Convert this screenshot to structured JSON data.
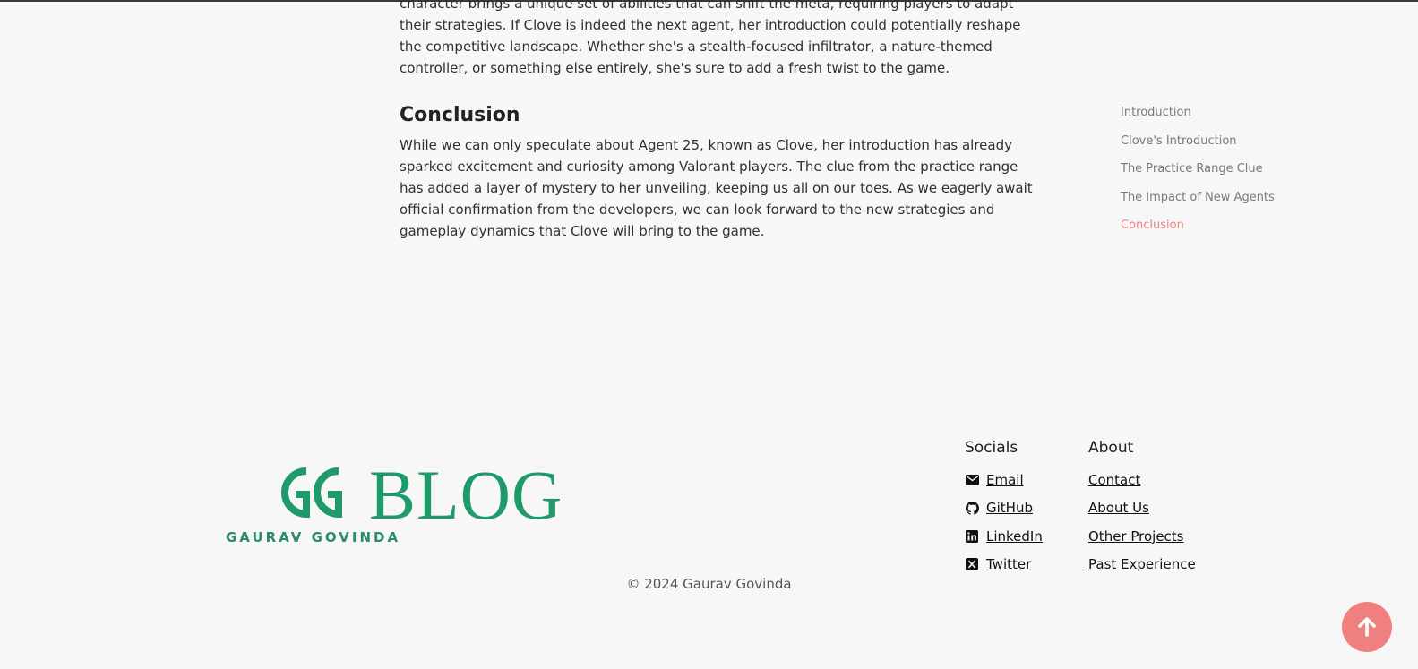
{
  "article": {
    "intro_paragraph": "character brings a unique set of abilities that can shift the meta, requiring players to adapt their strategies. If Clove is indeed the next agent, her introduction could potentially reshape the competitive landscape. Whether she's a stealth-focused infiltrator, a nature-themed controller, or something else entirely, she's sure to add a fresh twist to the game.",
    "conclusion_heading": "Conclusion",
    "conclusion_paragraph": "While we can only speculate about Agent 25, known as Clove, her introduction has already sparked excitement and curiosity among Valorant players. The clue from the practice range has added a layer of mystery to her unveiling, keeping us all on our toes. As we eagerly await official confirmation from the developers, we can look forward to the new strategies and gameplay dynamics that Clove will bring to the game."
  },
  "toc": {
    "items": [
      {
        "label": "Introduction"
      },
      {
        "label": "Clove's Introduction"
      },
      {
        "label": "The Practice Range Clue"
      },
      {
        "label": "The Impact of New Agents"
      },
      {
        "label": "Conclusion"
      }
    ],
    "active_index": 4,
    "active_color": "#f08080"
  },
  "footer": {
    "logo_text": "BLOG",
    "logo_subtext": "GAURAV GOVINDA",
    "brand_color": "#1f9a6b",
    "socials": {
      "heading": "Socials",
      "links": [
        {
          "label": "Email",
          "icon": "envelope-icon"
        },
        {
          "label": "GitHub",
          "icon": "github-icon"
        },
        {
          "label": "LinkedIn",
          "icon": "linkedin-icon"
        },
        {
          "label": "Twitter",
          "icon": "x-twitter-icon"
        }
      ]
    },
    "about": {
      "heading": "About",
      "links": [
        {
          "label": "Contact"
        },
        {
          "label": "About Us"
        },
        {
          "label": "Other Projects"
        },
        {
          "label": "Past Experience"
        }
      ]
    },
    "copyright": "© 2024 Gaurav Govinda"
  },
  "scroll_top": {
    "icon": "arrow-up-icon",
    "color": "#f08080"
  }
}
